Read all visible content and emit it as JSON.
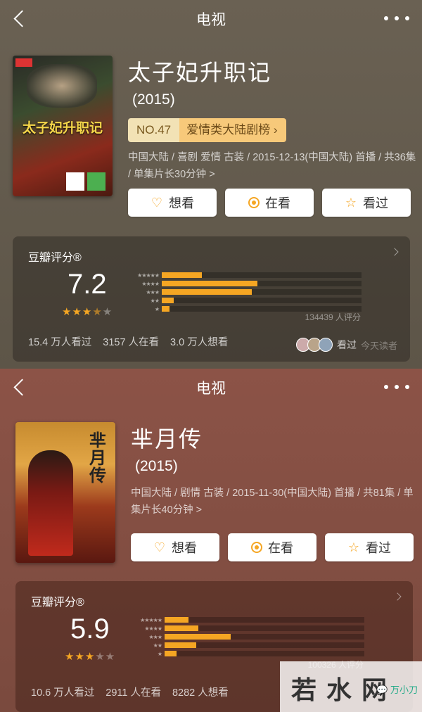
{
  "screen1": {
    "nav": {
      "title": "电视"
    },
    "show": {
      "title": "太子妃升职记",
      "year": "(2015)",
      "rank_num": "NO.47",
      "rank_category": "爱情类大陆剧榜",
      "meta": "中国大陆 / 喜剧 爱情 古装 / 2015-12-13(中国大陆) 首播 / 共36集 / 单集片长30分钟 >",
      "poster_title": "太子妃升职记"
    },
    "actions": {
      "want": "想看",
      "watching": "在看",
      "watched": "看过"
    },
    "rating": {
      "label": "豆瓣评分®",
      "score": "7.2",
      "stars_on": "★★★",
      "stars_half": "★",
      "stars_off": "★",
      "distribution": [
        0.2,
        0.48,
        0.45,
        0.06,
        0.04
      ],
      "count": "134439 人评分",
      "watched": "15.4 万人看过",
      "watching": "3157 人在看",
      "want": "3.0 万人想看",
      "friends_label": "看过",
      "friends_time": "今天读者"
    }
  },
  "screen2": {
    "nav": {
      "title": "电视"
    },
    "show": {
      "title": "芈月传",
      "year": "(2015)",
      "meta": "中国大陆 / 剧情 古装 / 2015-11-30(中国大陆) 首播 / 共81集 / 单集片长40分钟 >",
      "poster_title": "芈月传"
    },
    "actions": {
      "want": "想看",
      "watching": "在看",
      "watched": "看过"
    },
    "rating": {
      "label": "豆瓣评分®",
      "score": "5.9",
      "stars_on": "★★★",
      "stars_off": "★★",
      "distribution": [
        0.12,
        0.17,
        0.33,
        0.16,
        0.06
      ],
      "count": "100326 人评分",
      "watched": "10.6 万人看过",
      "watching": "2911 人在看",
      "want": "8282 人想看"
    }
  },
  "watermark": {
    "text": "若水网",
    "logo": "万小刀"
  },
  "colors": {
    "accent": "#f5a623",
    "rank_bg": "#f7c97a"
  },
  "icons": {
    "back": "chevron-left-icon",
    "more": "ellipsis-icon",
    "want": "heart-plus-icon",
    "watching": "target-icon",
    "watched": "star-icon"
  }
}
